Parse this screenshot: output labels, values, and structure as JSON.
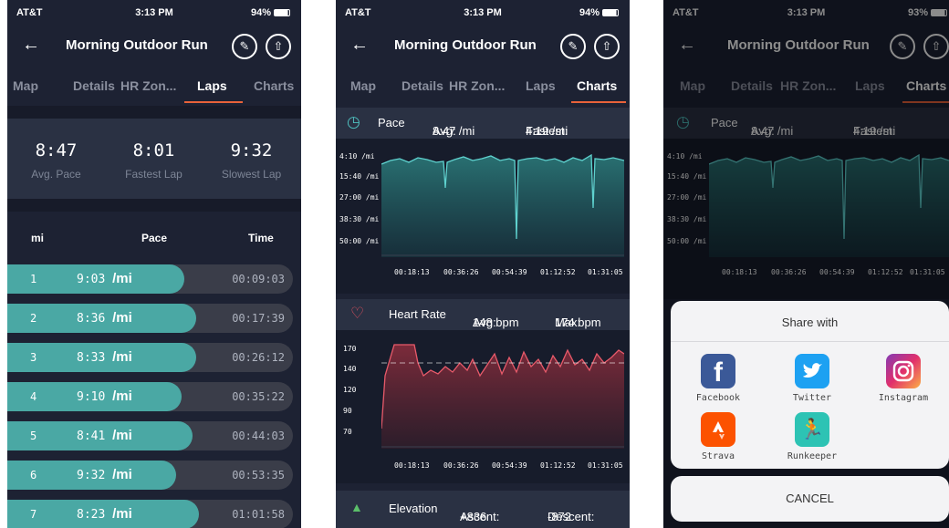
{
  "status": {
    "p1": {
      "carrier": "AT&T",
      "time": "3:13 PM",
      "battery": "94%"
    },
    "p2": {
      "carrier": "AT&T",
      "time": "3:13 PM",
      "battery": "94%"
    },
    "p3": {
      "carrier": "AT&T",
      "time": "3:13 PM",
      "battery": "93%"
    }
  },
  "header": {
    "title": "Morning Outdoor Run",
    "back_icon": "arrow-left-icon",
    "edit_icon": "pencil-icon",
    "share_icon": "share-icon"
  },
  "tabs": [
    "Map",
    "Details",
    "HR Zon...",
    "Laps",
    "Charts"
  ],
  "laps_screen": {
    "active_tab": "Laps",
    "summary": [
      {
        "value": "8:47",
        "label": "Avg. Pace"
      },
      {
        "value": "8:01",
        "label": "Fastest Lap"
      },
      {
        "value": "9:32",
        "label": "Slowest Lap"
      }
    ],
    "columns": {
      "unit": "mi",
      "pace": "Pace",
      "time": "Time"
    },
    "pace_unit": "/mi",
    "laps": [
      {
        "num": "1",
        "pace": "9:03",
        "time": "00:09:03",
        "fill": 0.62
      },
      {
        "num": "2",
        "pace": "8:36",
        "time": "00:17:39",
        "fill": 0.66
      },
      {
        "num": "3",
        "pace": "8:33",
        "time": "00:26:12",
        "fill": 0.66
      },
      {
        "num": "4",
        "pace": "9:10",
        "time": "00:35:22",
        "fill": 0.61
      },
      {
        "num": "5",
        "pace": "8:41",
        "time": "00:44:03",
        "fill": 0.65
      },
      {
        "num": "6",
        "pace": "9:32",
        "time": "00:53:35",
        "fill": 0.59
      },
      {
        "num": "7",
        "pace": "8:23",
        "time": "01:01:58",
        "fill": 0.67
      }
    ]
  },
  "charts_screen": {
    "active_tab": "Charts",
    "pace": {
      "label": "Pace",
      "avg_label": "Avg:",
      "avg": "8:47 /mi",
      "fastest_label": "Fastest:",
      "fastest": "4:19 /mi",
      "yticks": [
        "4:10 /mi",
        "15:40 /mi",
        "27:00 /mi",
        "38:30 /mi",
        "50:00 /mi"
      ],
      "xticks": [
        "00:18:13",
        "00:36:26",
        "00:54:39",
        "01:12:52",
        "01:31:05"
      ],
      "color": "#4fc1c0"
    },
    "heart_rate": {
      "label": "Heart Rate",
      "avg_label": "Avg:",
      "avg": "148 bpm",
      "max_label": "Max:",
      "max": "174 bpm",
      "yticks": [
        "170",
        "140",
        "120",
        "90",
        "70"
      ],
      "xticks": [
        "00:18:13",
        "00:36:26",
        "00:54:39",
        "01:12:52",
        "01:31:05"
      ],
      "color": "#e0505f"
    },
    "elevation": {
      "label": "Elevation",
      "ascent_label": "Ascent:",
      "ascent": "+836",
      "descent_label": "Descent:",
      "descent": "-872"
    }
  },
  "share_sheet": {
    "title": "Share with",
    "apps": [
      {
        "name": "Facebook",
        "icon": "facebook-icon",
        "color": "#3b5998"
      },
      {
        "name": "Twitter",
        "icon": "twitter-icon",
        "color": "#1da1f2"
      },
      {
        "name": "Instagram",
        "icon": "instagram-icon",
        "color": "#c13584"
      },
      {
        "name": "Strava",
        "icon": "strava-icon",
        "color": "#fc5200"
      },
      {
        "name": "Runkeeper",
        "icon": "runkeeper-icon",
        "color": "#2dc3b4"
      }
    ],
    "cancel": "CANCEL"
  }
}
